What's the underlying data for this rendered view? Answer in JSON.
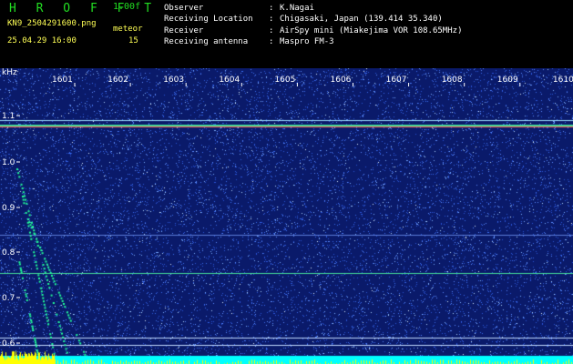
{
  "header": {
    "logo": "H R O F F T",
    "version": "1.00f",
    "filename": "KN9_2504291600.png",
    "meteor_label": "meteor",
    "datetime": "25.04.29 16:00",
    "meteor_count": "15",
    "info": [
      {
        "key": "Observer",
        "value": "K.Nagai"
      },
      {
        "key": "Receiving Location",
        "value": "Chigasaki, Japan (139.414 35.340)"
      },
      {
        "key": "Receiver",
        "value": "AirSpy mini (Miakejima VOR 108.65MHz)"
      },
      {
        "key": "Receiving antenna",
        "value": "Maspro FM-3"
      }
    ]
  },
  "spectrogram": {
    "y_unit": "kHz",
    "y_ticks": [
      "1.1",
      "1.0",
      "0.9",
      "0.8",
      "0.7",
      "0.6"
    ],
    "x_ticks": [
      "1601",
      "1602",
      "1603",
      "1604",
      "1605",
      "1606",
      "1607",
      "1608",
      "1609",
      "1610"
    ],
    "colors": {
      "background": "#0a1a6a",
      "carrier": "#ff5555",
      "line": "#44dd99",
      "meteor": "#22ff99",
      "bottom_band": "#00ffff",
      "bottom_noise": "#ffff00"
    }
  }
}
